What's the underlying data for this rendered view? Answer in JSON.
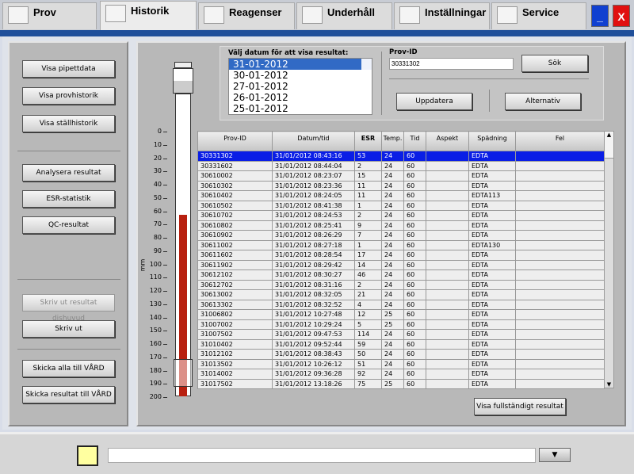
{
  "tabs": [
    {
      "label": "Prov",
      "icon": "pipette-icon"
    },
    {
      "label": "Historik",
      "icon": "tubes-icon",
      "active": true
    },
    {
      "label": "Reagenser",
      "icon": "reagent-icon"
    },
    {
      "label": "Underhåll",
      "icon": "maintenance-icon"
    },
    {
      "label": "Inställningar",
      "icon": "settings-icon"
    },
    {
      "label": "Service",
      "icon": "service-icon"
    }
  ],
  "window": {
    "minimize": "_",
    "close": "X"
  },
  "left": {
    "buttons": [
      "Visa pipettdata",
      "Visa provhistorik",
      "Visa ställhistorik",
      "Analysera resultat",
      "ESR-statistik",
      "QC-resultat",
      "Skriv ut resultat dishuvud",
      "Skriv ut",
      "Skicka alla till VÅRD",
      "Skicka resultat till VÅRD"
    ]
  },
  "tube": {
    "scale_unit": "mm",
    "ticks": [
      "0",
      "10",
      "20",
      "30",
      "40",
      "50",
      "60",
      "70",
      "80",
      "90",
      "100",
      "110",
      "120",
      "130",
      "140",
      "150",
      "160",
      "170",
      "180",
      "190",
      "200"
    ],
    "level_mm": 63
  },
  "date_picker": {
    "label": "Välj datum för att visa resultat:",
    "options": [
      "31-01-2012",
      "30-01-2012",
      "27-01-2012",
      "26-01-2012",
      "25-01-2012"
    ],
    "selected": "31-01-2012"
  },
  "search": {
    "label": "Prov-ID",
    "value": "30331302",
    "button": "Sök"
  },
  "actions": {
    "update": "Uppdatera",
    "options": "Alternativ"
  },
  "table": {
    "headers": [
      "Prov-ID",
      "Datum/tid",
      "ESR",
      "Temp.",
      "Tid",
      "Aspekt",
      "Spädning",
      "Fel"
    ],
    "rows": [
      [
        "30331302",
        "31/01/2012 08:43:16",
        "53",
        "24",
        "60",
        "",
        "EDTA",
        ""
      ],
      [
        "30331602",
        "31/01/2012 08:44:04",
        "2",
        "24",
        "60",
        "",
        "EDTA",
        ""
      ],
      [
        "30610002",
        "31/01/2012 08:23:07",
        "15",
        "24",
        "60",
        "",
        "EDTA",
        ""
      ],
      [
        "30610302",
        "31/01/2012 08:23:36",
        "11",
        "24",
        "60",
        "",
        "EDTA",
        ""
      ],
      [
        "30610402",
        "31/01/2012 08:24:05",
        "11",
        "24",
        "60",
        "",
        "EDTA113",
        ""
      ],
      [
        "30610502",
        "31/01/2012 08:41:38",
        "1",
        "24",
        "60",
        "",
        "EDTA",
        ""
      ],
      [
        "30610702",
        "31/01/2012 08:24:53",
        "2",
        "24",
        "60",
        "",
        "EDTA",
        ""
      ],
      [
        "30610802",
        "31/01/2012 08:25:41",
        "9",
        "24",
        "60",
        "",
        "EDTA",
        ""
      ],
      [
        "30610902",
        "31/01/2012 08:26:29",
        "7",
        "24",
        "60",
        "",
        "EDTA",
        ""
      ],
      [
        "30611002",
        "31/01/2012 08:27:18",
        "1",
        "24",
        "60",
        "",
        "EDTA130",
        ""
      ],
      [
        "30611602",
        "31/01/2012 08:28:54",
        "17",
        "24",
        "60",
        "",
        "EDTA",
        ""
      ],
      [
        "30611902",
        "31/01/2012 08:29:42",
        "14",
        "24",
        "60",
        "",
        "EDTA",
        ""
      ],
      [
        "30612102",
        "31/01/2012 08:30:27",
        "46",
        "24",
        "60",
        "",
        "EDTA",
        ""
      ],
      [
        "30612702",
        "31/01/2012 08:31:16",
        "2",
        "24",
        "60",
        "",
        "EDTA",
        ""
      ],
      [
        "30613002",
        "31/01/2012 08:32:05",
        "21",
        "24",
        "60",
        "",
        "EDTA",
        ""
      ],
      [
        "30613302",
        "31/01/2012 08:32:52",
        "4",
        "24",
        "60",
        "",
        "EDTA",
        ""
      ],
      [
        "31006802",
        "31/01/2012 10:27:48",
        "12",
        "25",
        "60",
        "",
        "EDTA",
        ""
      ],
      [
        "31007002",
        "31/01/2012 10:29:24",
        "5",
        "25",
        "60",
        "",
        "EDTA",
        ""
      ],
      [
        "31007502",
        "31/01/2012 09:47:53",
        "114",
        "24",
        "60",
        "",
        "EDTA",
        ""
      ],
      [
        "31010402",
        "31/01/2012 09:52:44",
        "59",
        "24",
        "60",
        "",
        "EDTA",
        ""
      ],
      [
        "31012102",
        "31/01/2012 08:38:43",
        "50",
        "24",
        "60",
        "",
        "EDTA",
        ""
      ],
      [
        "31013502",
        "31/01/2012 10:26:12",
        "51",
        "24",
        "60",
        "",
        "EDTA",
        ""
      ],
      [
        "31014002",
        "31/01/2012 09:36:28",
        "92",
        "24",
        "60",
        "",
        "EDTA",
        ""
      ],
      [
        "31017502",
        "31/01/2012 13:18:26",
        "75",
        "25",
        "60",
        "",
        "EDTA",
        ""
      ]
    ],
    "selected_row": 0
  },
  "full_result_button": "Visa fullständigt resultat",
  "status": {
    "message": "",
    "icon": "note-icon"
  },
  "colors": {
    "band": "#1f4f9a",
    "selection": "#0a1ee6",
    "tube_fill": "#b82010"
  }
}
